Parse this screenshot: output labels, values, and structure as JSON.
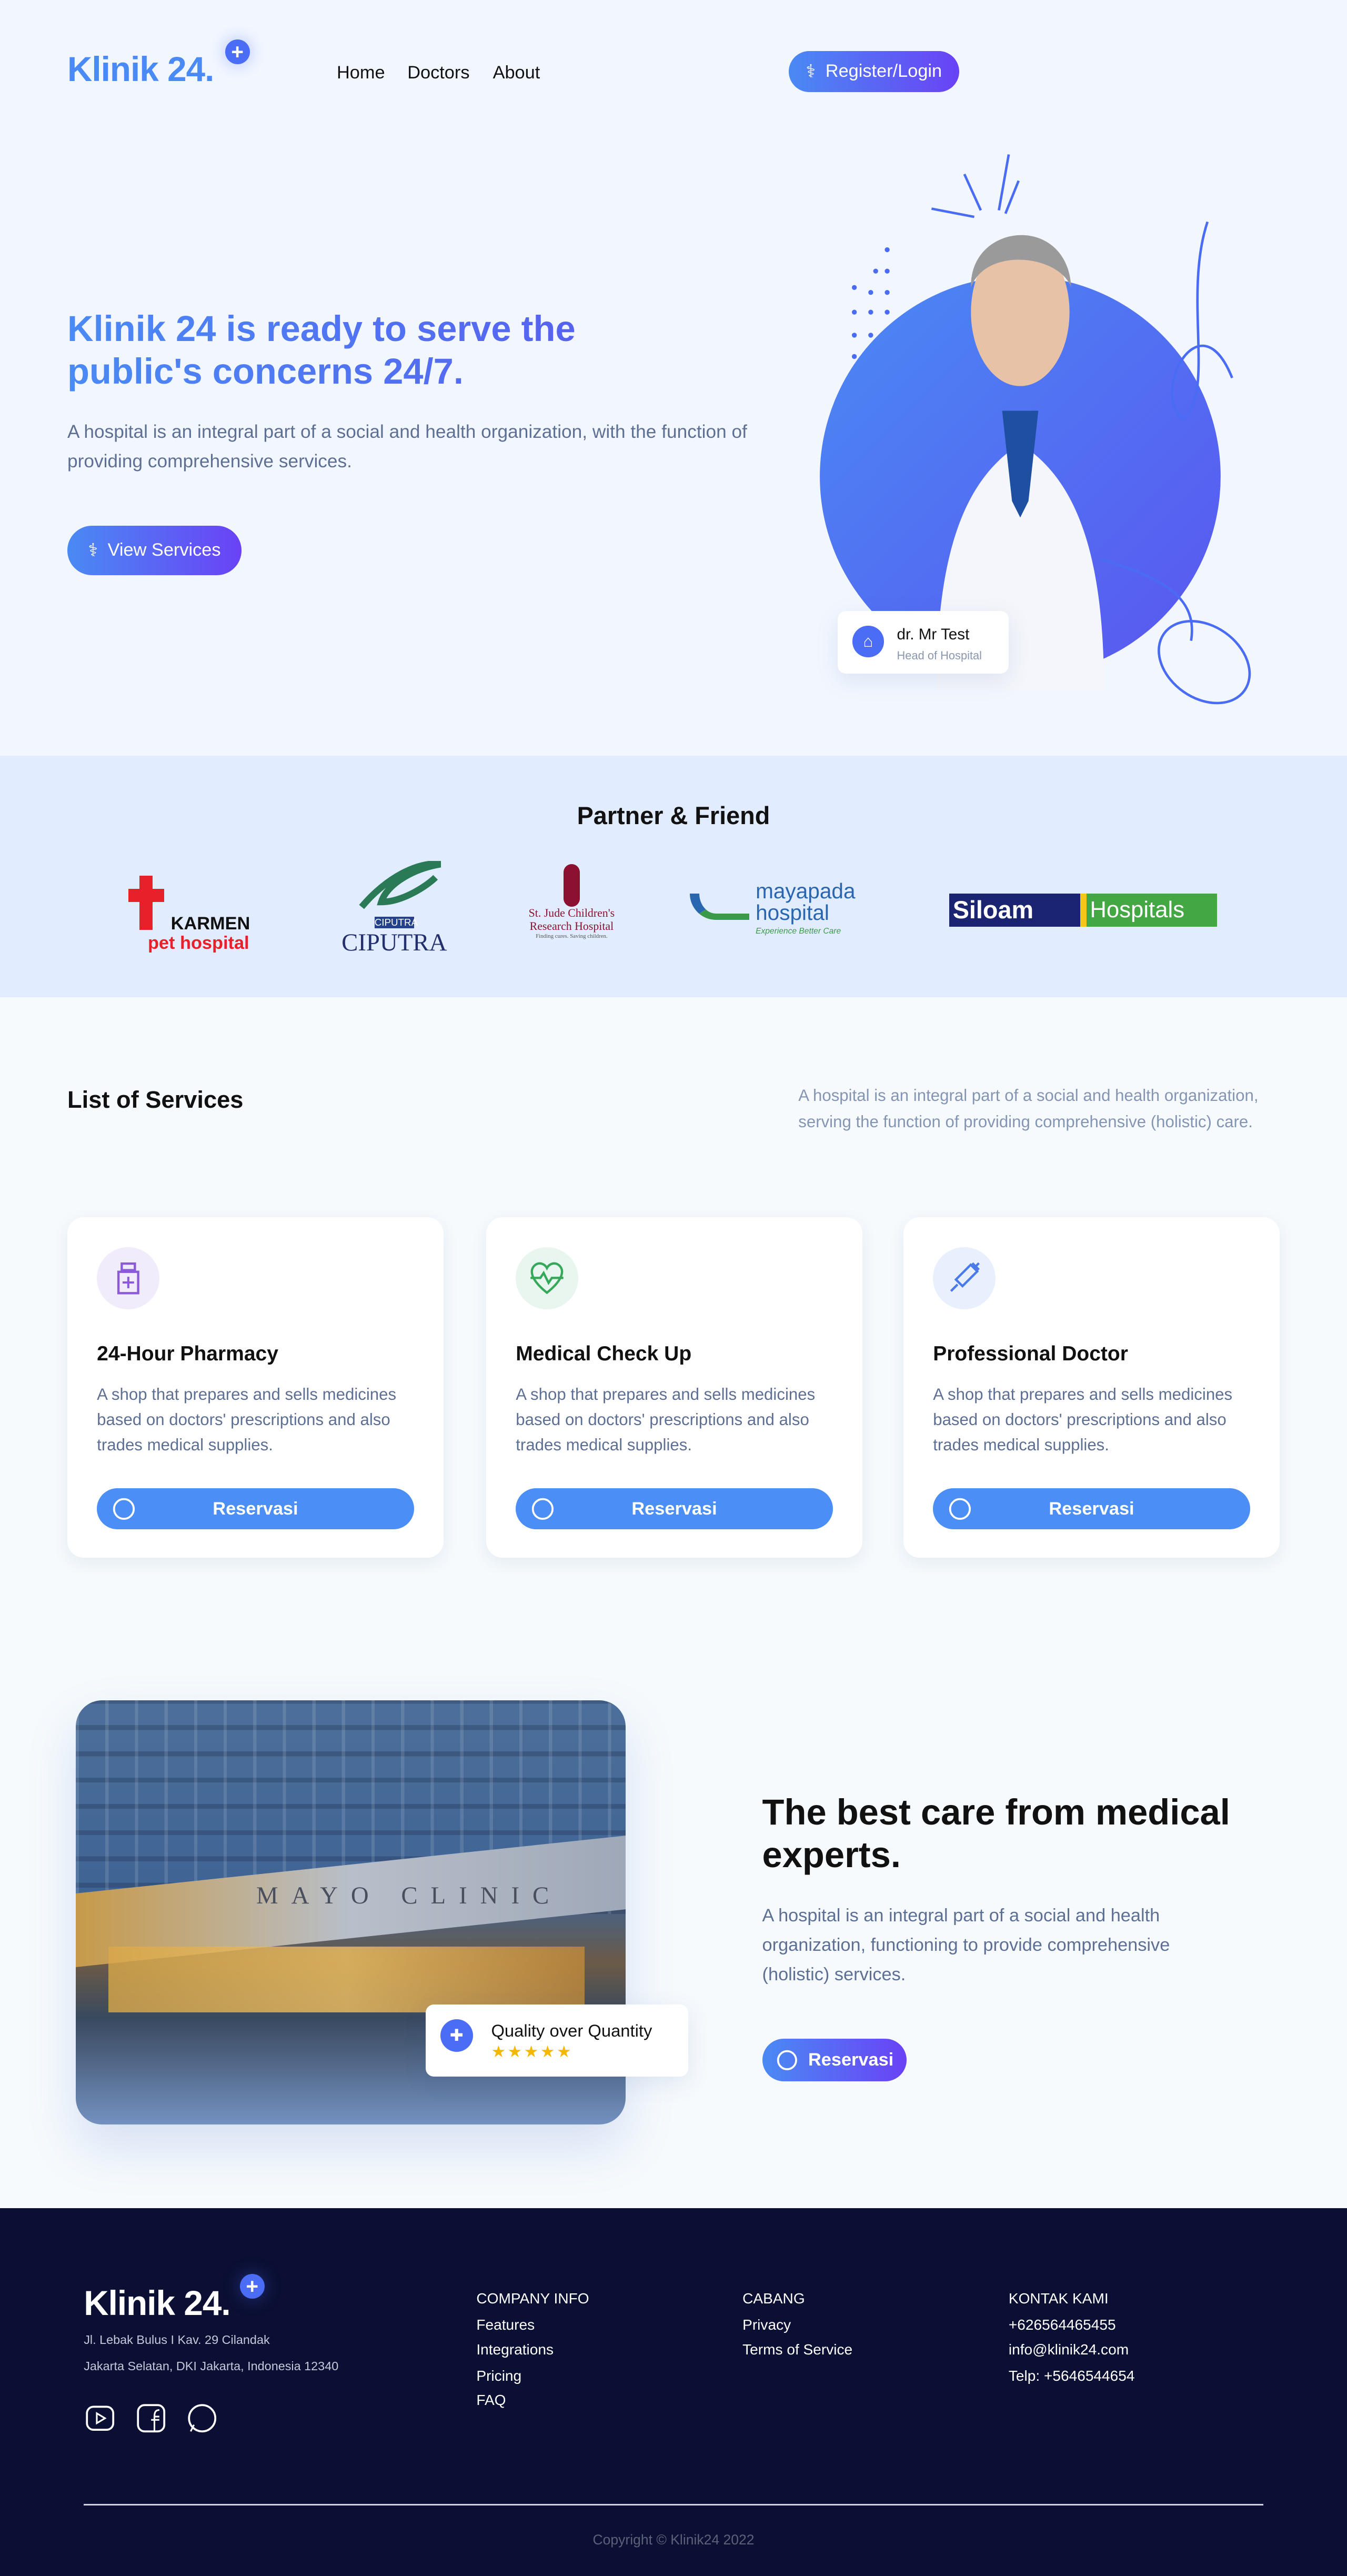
{
  "brand": {
    "name": "Klinik 24.",
    "plus": "+",
    "accent": "#4a8af4",
    "accent_end": "#6a42f5",
    "footer_bg": "#0b0f33"
  },
  "nav": {
    "items": [
      "Home",
      "Doctors",
      "About"
    ],
    "register": "Register/Login"
  },
  "hero": {
    "title_line1": "Klinik 24 is ready to serve the",
    "title_line2": "public's concerns 24/7.",
    "description": "A hospital is an integral part of a social and health organization, with the function of providing comprehensive services.",
    "button": "View Services",
    "doctor_name": "dr. Mr Test",
    "doctor_role": "Head of Hospital"
  },
  "partners": {
    "title": "Partner & Friend",
    "logos": [
      {
        "line1": "KARMEN",
        "line2": "pet hospital"
      },
      {
        "badge": "CIPUTRA",
        "line1": "CIPUTRA"
      },
      {
        "line1": "St. Jude Children's",
        "line2": "Research Hospital",
        "line3": "Finding cures. Saving children."
      },
      {
        "line1": "mayapada",
        "line2": "hospital",
        "line3": "Experience Better Care"
      },
      {
        "line1": "Siloam",
        "line2": "Hospitals"
      }
    ]
  },
  "services": {
    "title": "List of Services",
    "description": "A hospital is an integral part of a social and health organization, serving the function of providing comprehensive (holistic) care.",
    "cards": [
      {
        "icon": "medicine-bottle-icon",
        "title": "24-Hour Pharmacy",
        "text": "A shop that prepares and sells medicines based on doctors' prescriptions and also trades medical supplies.",
        "button": "Reservasi"
      },
      {
        "icon": "heartbeat-icon",
        "title": "Medical Check Up",
        "text": "A shop that prepares and sells medicines based on doctors' prescriptions and also trades medical supplies.",
        "button": "Reservasi"
      },
      {
        "icon": "syringe-icon",
        "title": "Professional Doctor",
        "text": "A shop that prepares and sells medicines based on doctors' prescriptions and also trades medical supplies.",
        "button": "Reservasi"
      }
    ]
  },
  "care": {
    "title": "The best care from medical experts.",
    "description": "A hospital is an integral part of a social and health organization, functioning to provide comprehensive (holistic) services.",
    "button": "Reservasi",
    "badge": "Quality over Quantity",
    "stars": "★★★★★",
    "rating": 5,
    "sign_text": "MAYO CLINIC"
  },
  "footer": {
    "address1": "Jl. Lebak Bulus I Kav. 29 Cilandak",
    "address2": "Jakarta Selatan, DKI Jakarta, Indonesia 12340",
    "columns": [
      {
        "title": "COMPANY INFO",
        "items": [
          "Features",
          "Integrations",
          "Pricing",
          "FAQ"
        ]
      },
      {
        "title": "CABANG",
        "items": [
          "Privacy",
          "Terms of Service"
        ]
      },
      {
        "title": "KONTAK KAMI",
        "items": [
          "+626564465455",
          "info@klinik24.com",
          "Telp: +5646544654"
        ]
      }
    ],
    "copyright": "Copyright © Klinik24 2022"
  }
}
